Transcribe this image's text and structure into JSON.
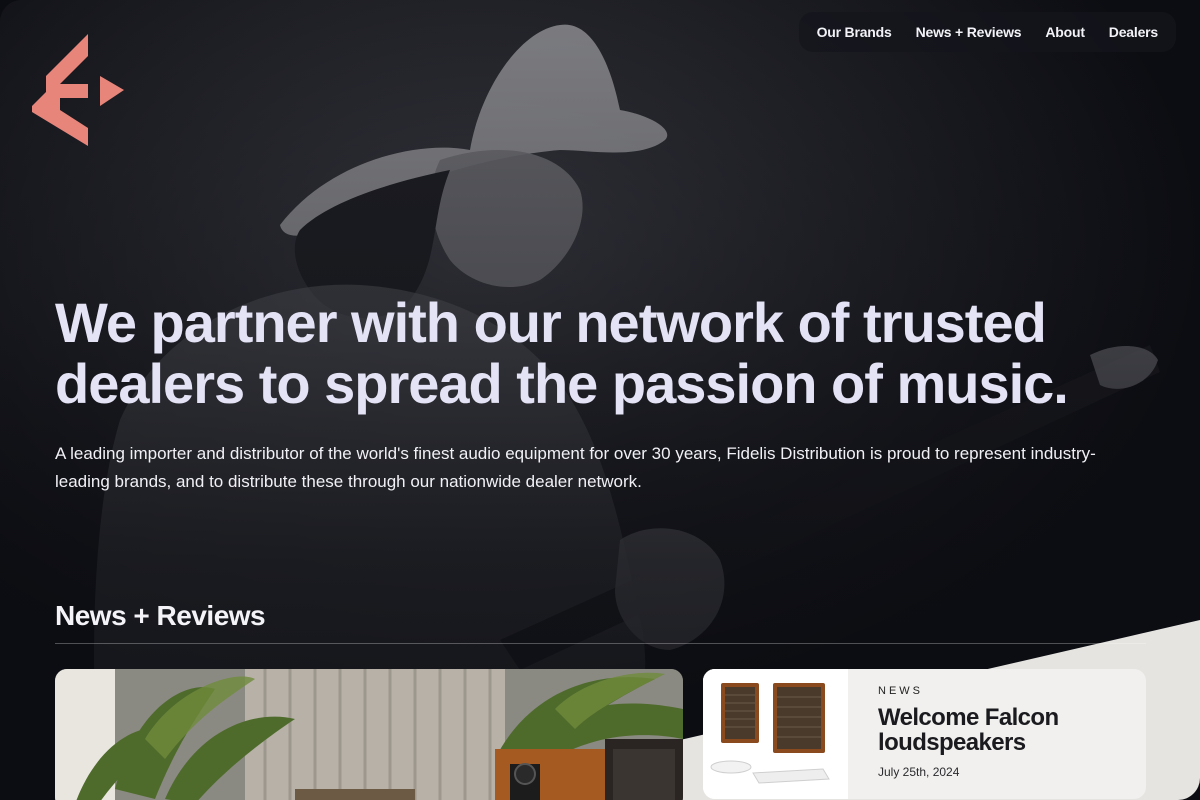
{
  "nav": {
    "items": [
      "Our Brands",
      "News + Reviews",
      "About",
      "Dealers"
    ]
  },
  "brand": {
    "accent": "#e8857a"
  },
  "hero": {
    "title": "We partner with our network of trusted dealers to spread the passion of music.",
    "text": "A leading importer and distributor of the world's finest audio equipment for over 30 years, Fidelis Distribution is proud to represent industry-leading brands, and to distribute these through our nationwide dealer network."
  },
  "news": {
    "section_title": "News + Reviews",
    "card": {
      "kicker": "NEWS",
      "title": "Welcome Falcon loudspeakers",
      "date": "July 25th, 2024"
    }
  }
}
